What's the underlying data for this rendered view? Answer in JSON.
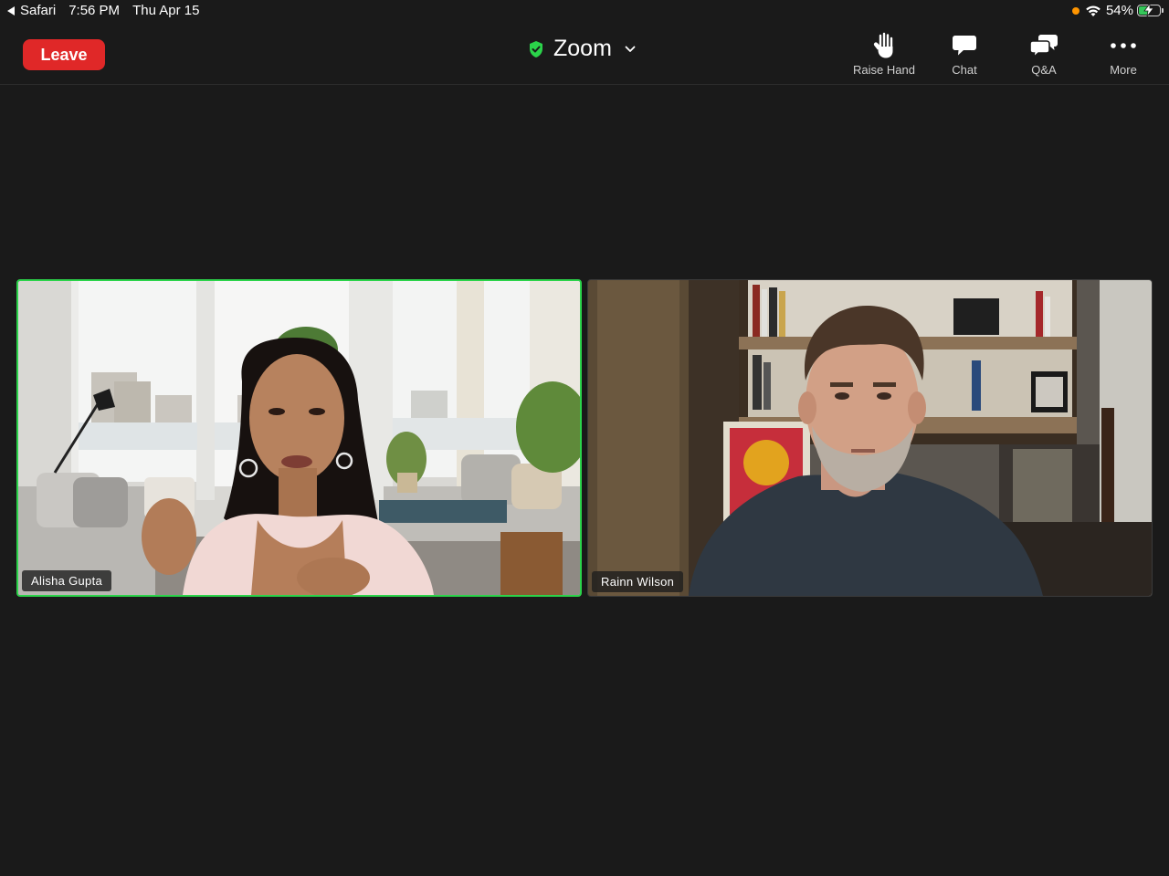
{
  "status_bar": {
    "back_app": "Safari",
    "time": "7:56 PM",
    "date": "Thu Apr 15",
    "battery": "54%",
    "battery_level": 0.54
  },
  "toolbar": {
    "leave_label": "Leave",
    "meeting_title": "Zoom",
    "buttons": [
      {
        "label": "Raise Hand",
        "icon": "raise-hand-icon"
      },
      {
        "label": "Chat",
        "icon": "chat-icon"
      },
      {
        "label": "Q&A",
        "icon": "qa-icon"
      },
      {
        "label": "More",
        "icon": "more-icon"
      }
    ]
  },
  "participants": [
    {
      "name": "Alisha Gupta",
      "active_speaker": true
    },
    {
      "name": "Rainn Wilson",
      "active_speaker": false
    }
  ],
  "colors": {
    "background": "#1a1a1a",
    "leave_red": "#e02828",
    "active_speaker_green": "#2bd34a",
    "shield_green": "#2bd34a",
    "battery_green": "#34c759",
    "recording_dot": "#ff9500"
  }
}
